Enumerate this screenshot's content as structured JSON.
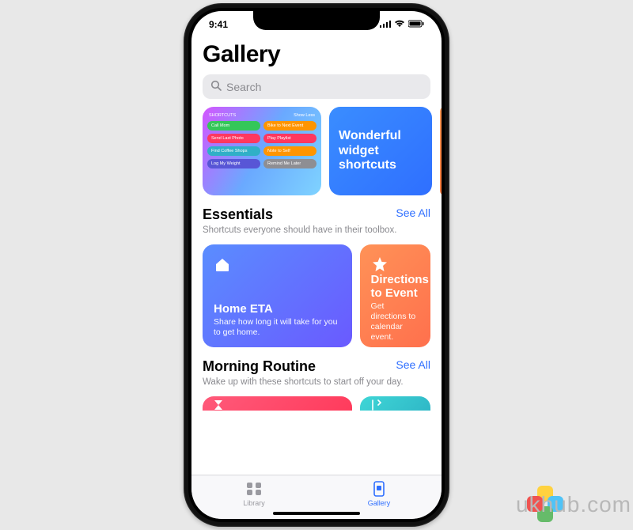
{
  "status": {
    "time": "9:41"
  },
  "page": {
    "title": "Gallery"
  },
  "search": {
    "placeholder": "Search"
  },
  "hero": {
    "widget_header_left": "SHORTCUTS",
    "widget_header_right": "Show Less",
    "pills": [
      {
        "label": "Call Mom",
        "color": "#34c759"
      },
      {
        "label": "Bike to Next Event",
        "color": "#ff9500"
      },
      {
        "label": "Send Last Photo",
        "color": "#ff375f"
      },
      {
        "label": "Play Playlist",
        "color": "#ff375f"
      },
      {
        "label": "Find Coffee Shops",
        "color": "#30b0c7"
      },
      {
        "label": "Note to Self",
        "color": "#ff9500"
      },
      {
        "label": "Log My Weight",
        "color": "#5856d6"
      },
      {
        "label": "Remind Me Later",
        "color": "#8e8e93"
      }
    ],
    "wonderful_title": "Wonderful widget shortcuts"
  },
  "essentials": {
    "title": "Essentials",
    "see_all": "See All",
    "subtitle": "Shortcuts everyone should have in their toolbox.",
    "cards": [
      {
        "icon": "home-icon",
        "title": "Home ETA",
        "desc": "Share how long it will take for you to get home."
      },
      {
        "icon": "star-icon",
        "title": "Directions to Event",
        "desc": "Get directions to calendar event."
      }
    ]
  },
  "morning": {
    "title": "Morning Routine",
    "see_all": "See All",
    "subtitle": "Wake up with these shortcuts to start off your day."
  },
  "tabs": {
    "library": "Library",
    "gallery": "Gallery"
  },
  "watermark": {
    "text": "ukhub.com"
  }
}
